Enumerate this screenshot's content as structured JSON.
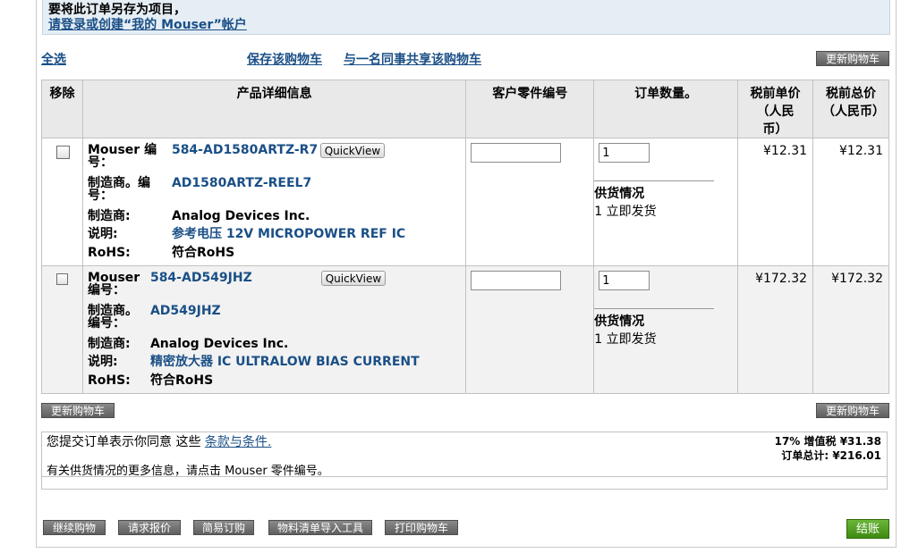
{
  "notice": {
    "line1": "要将此订单另存为项目，",
    "line2": "请登录或创建“我的 Mouser”帐户"
  },
  "toolbar": {
    "select_all": "全选",
    "save_cart": "保存该购物车",
    "share_cart": "与一名同事共享该购物车",
    "update_cart": "更新购物车"
  },
  "table": {
    "headers": {
      "remove": "移除",
      "product": "产品详细信息",
      "customer_part": "客户零件编号",
      "qty": "订单数量。",
      "unit_price": "税前单价（人民币）",
      "ext_price": "税前总价（人民币）"
    },
    "labels": {
      "mouser_no": "Mouser 编号：",
      "mfr_no": "制造商。编号：",
      "mfr": "制造商:",
      "desc": "说明:",
      "rohs": "RoHS:",
      "quickview": "QuickView",
      "availability": "供货情况"
    },
    "rows": [
      {
        "mouser_no": "584-AD1580ARTZ-R7",
        "mfr_no": "AD1580ARTZ-REEL7",
        "mfr": "Analog Devices Inc.",
        "desc": "参考电压 12V MICROPOWER REF IC",
        "rohs": "符合RoHS",
        "customer_part": "",
        "qty": "1",
        "availability": "1 立即发货",
        "unit_price": "¥12.31",
        "ext_price": "¥12.31"
      },
      {
        "mouser_no": "584-AD549JHZ",
        "mfr_no": "AD549JHZ",
        "mfr": "Analog Devices Inc.",
        "desc": "精密放大器 IC ULTRALOW BIAS CURRENT",
        "rohs": "符合RoHS",
        "customer_part": "",
        "qty": "1",
        "availability": "1 立即发货",
        "unit_price": "¥172.32",
        "ext_price": "¥172.32"
      }
    ]
  },
  "footer": {
    "terms_prefix": "您提交订单表示你同意 这些",
    "terms_link": "条款与条件.",
    "avail_note": "有关供货情况的更多信息，请点击 Mouser 零件编号。",
    "tax": "17% 增值税  ¥31.38",
    "total": "订单总计: ¥216.01"
  },
  "actions": {
    "continue": "继续购物",
    "quote": "请求报价",
    "easy_order": "简易订购",
    "bom_import": "物料清单导入工具",
    "print": "打印购物车",
    "checkout": "结账"
  },
  "colors": {
    "link": "#1a4f86",
    "button_gray": "#6f6f6f",
    "checkout_green": "#4f9a22"
  }
}
